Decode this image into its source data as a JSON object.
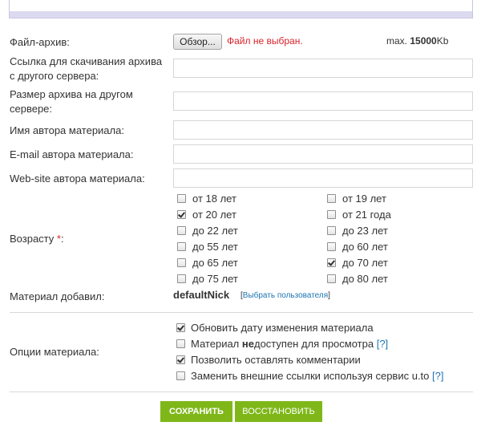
{
  "file": {
    "label": "Файл-архив:",
    "browse_button": "Обзор...",
    "status": "Файл не выбран.",
    "max_prefix": "max.",
    "max_value": "15000",
    "max_unit": "Kb"
  },
  "fields": {
    "remote_link_label_line1": "Ссылка для скачивания архива",
    "remote_link_label_line2": "с другого сервера:",
    "remote_size_label_line1": "Размер архива на другом",
    "remote_size_label_line2": "сервере:",
    "author_name_label": "Имя автора материала:",
    "author_email_label": "E-mail автора материала:",
    "author_site_label": "Web-site автора материала:"
  },
  "age": {
    "label": "Возрасту",
    "required_mark": "*",
    "label_colon": ":",
    "options": [
      {
        "label": "от 18 лет",
        "checked": false
      },
      {
        "label": "от 19 лет",
        "checked": false
      },
      {
        "label": "от 20 лет",
        "checked": true
      },
      {
        "label": "от 21 года",
        "checked": false
      },
      {
        "label": "до 22 лет",
        "checked": false
      },
      {
        "label": "до 23 лет",
        "checked": false
      },
      {
        "label": "до 55 лет",
        "checked": false
      },
      {
        "label": "до 60 лет",
        "checked": false
      },
      {
        "label": "до 65 лет",
        "checked": false
      },
      {
        "label": "до 70 лет",
        "checked": true
      },
      {
        "label": "до 75 лет",
        "checked": false
      },
      {
        "label": "до 80 лет",
        "checked": false
      }
    ]
  },
  "added_by": {
    "label": "Материал добавил:",
    "nick": "defaultNick",
    "pick_open": "[",
    "pick_user": "Выбрать пользователя",
    "pick_close": "]"
  },
  "options": {
    "label": "Опции материала:",
    "update_date": {
      "label": "Обновить дату изменения материала",
      "checked": true
    },
    "unavailable": {
      "prefix": "Материал ",
      "bold": "не",
      "suffix": "доступен для просмотра",
      "help": "[?]",
      "checked": false
    },
    "allow_comments": {
      "label": "Позволить оставлять комментарии",
      "checked": true
    },
    "replace_links": {
      "label": "Заменить внешние ссылки используя сервис u.to",
      "help": "[?]",
      "checked": false
    }
  },
  "buttons": {
    "save": "СОХРАНИТЬ",
    "reset": "ВОССТАНОВИТЬ"
  }
}
